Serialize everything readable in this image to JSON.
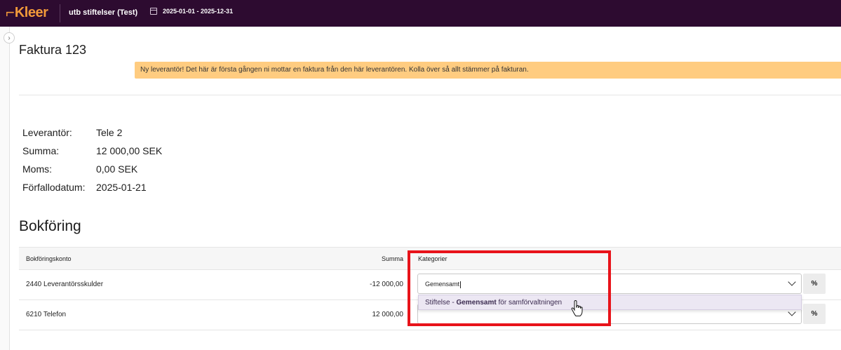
{
  "app": {
    "logo_text": "Kleer",
    "organization": "utb stiftelser (Test)",
    "period": "2025-01-01 - 2025-12-31"
  },
  "page": {
    "title": "Faktura 123",
    "alert": "Ny leverantör! Det här är första gången ni mottar en faktura från den här leverantören. Kolla över så allt stämmer på fakturan."
  },
  "invoice": {
    "fields": [
      {
        "label": "Leverantör:",
        "value": "Tele 2"
      },
      {
        "label": "Summa:",
        "value": "12 000,00 SEK"
      },
      {
        "label": "Moms:",
        "value": "0,00 SEK"
      },
      {
        "label": "Förfallodatum:",
        "value": "2025-01-21"
      }
    ]
  },
  "bookkeeping": {
    "title": "Bokföring",
    "columns": {
      "account": "Bokföringskonto",
      "sum": "Summa",
      "categories": "Kategorier"
    },
    "rows": [
      {
        "account": "2440 Leverantörsskulder",
        "sum": "-12 000,00",
        "category_value": "Gemensamt",
        "percent_label": "%"
      },
      {
        "account": "6210 Telefon",
        "sum": "12 000,00",
        "category_value": "",
        "percent_label": "%"
      }
    ],
    "dropdown_option": {
      "prefix": "Stiftelse - ",
      "bold": "Gemensamt",
      "suffix": " för samförvaltningen"
    }
  },
  "colors": {
    "topbar": "#2d0b30",
    "brand": "#f29a3a",
    "alert": "#ffcc80",
    "highlight": "#e8131a"
  }
}
